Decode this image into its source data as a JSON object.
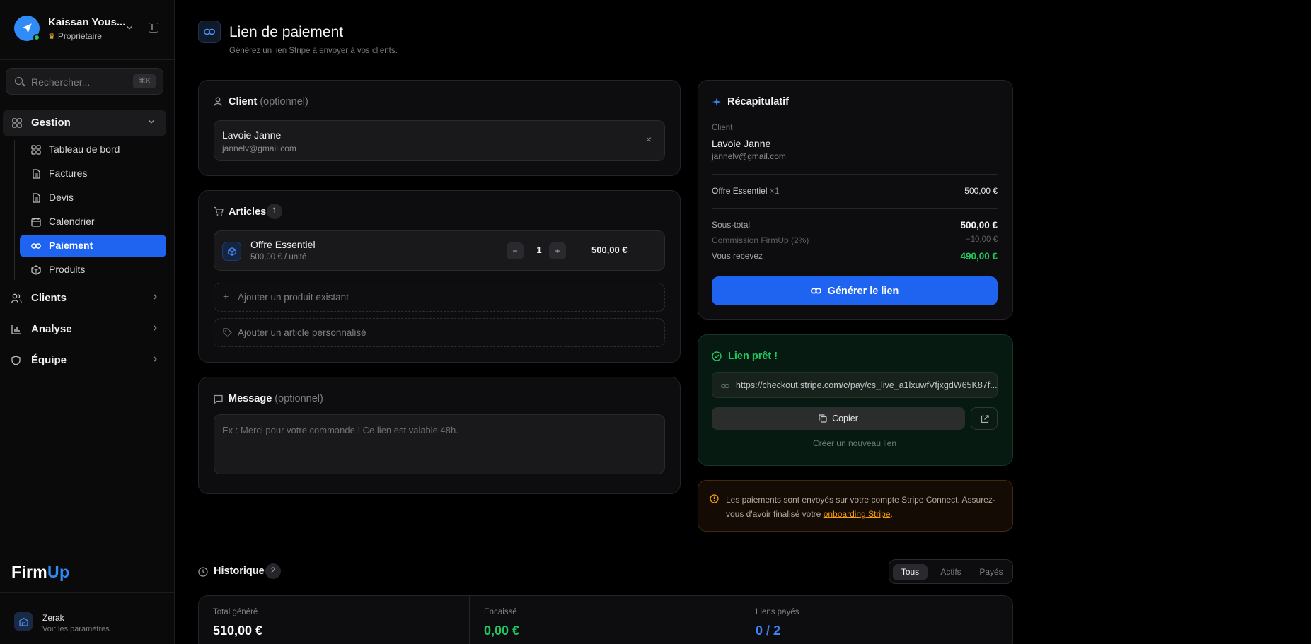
{
  "profile": {
    "name": "Kaissan Yous...",
    "role": "Propriétaire"
  },
  "search": {
    "placeholder": "Rechercher...",
    "shortcut": "⌘K"
  },
  "nav": {
    "group_label": "Gestion",
    "sub_items": [
      {
        "label": "Tableau de bord"
      },
      {
        "label": "Factures"
      },
      {
        "label": "Devis"
      },
      {
        "label": "Calendrier"
      },
      {
        "label": "Paiement"
      },
      {
        "label": "Produits"
      }
    ],
    "main_items": [
      {
        "label": "Clients"
      },
      {
        "label": "Analyse"
      },
      {
        "label": "Équipe"
      }
    ]
  },
  "brand": {
    "part1": "Firm",
    "part2": "Up"
  },
  "workspace": {
    "name": "Zerak",
    "sub": "Voir les paramètres"
  },
  "page": {
    "title": "Lien de paiement",
    "subtitle": "Générez un lien Stripe à envoyer à vos clients."
  },
  "client_card": {
    "title": "Client",
    "optional": "(optionnel)",
    "name": "Lavoie Janne",
    "email": "jannelv@gmail.com",
    "remove": "×"
  },
  "articles_card": {
    "title": "Articles",
    "count": "1",
    "item": {
      "name": "Offre Essentiel",
      "unit_price": "500,00 € / unité",
      "qty": "1",
      "minus": "−",
      "plus": "+",
      "total": "500,00 €"
    },
    "add_existing": "Ajouter un produit existant",
    "add_custom": "Ajouter un article personnalisé"
  },
  "message_card": {
    "title": "Message",
    "optional": "(optionnel)",
    "placeholder": "Ex : Merci pour votre commande ! Ce lien est valable 48h."
  },
  "summary": {
    "title": "Récapitulatif",
    "client_label": "Client",
    "client_name": "Lavoie Janne",
    "client_email": "jannelv@gmail.com",
    "item_label": "Offre Essentiel",
    "item_qty": "×1",
    "item_amount": "500,00 €",
    "subtotal_label": "Sous-total",
    "subtotal": "500,00 €",
    "commission_label": "Commission FirmUp (2%)",
    "commission": "−10,00 €",
    "receive_label": "Vous recevez",
    "receive": "490,00 €",
    "generate_label": "Générer le lien"
  },
  "ready": {
    "title": "Lien prêt !",
    "url": "https://checkout.stripe.com/c/pay/cs_live_a1lxuwfVfjxgdW65K87f...",
    "copy_label": "Copier",
    "new_link": "Créer un nouveau lien"
  },
  "warning": {
    "text": "Les paiements sont envoyés sur votre compte Stripe Connect. Assurez-vous d'avoir finalisé votre ",
    "link": "onboarding Stripe",
    "end": "."
  },
  "history": {
    "title": "Historique",
    "count": "2",
    "filters": [
      "Tous",
      "Actifs",
      "Payés"
    ],
    "stats": [
      {
        "label": "Total généré",
        "value": "510,00 €",
        "color": "#ffffff"
      },
      {
        "label": "Encaissé",
        "value": "0,00 €",
        "color": "#22c55e"
      },
      {
        "label": "Liens payés",
        "value": "0 / 2",
        "color": "#3b82f6"
      }
    ]
  },
  "colors": {
    "accent": "#1f64f1",
    "success": "#22c55e",
    "warning": "#f59e0b"
  }
}
